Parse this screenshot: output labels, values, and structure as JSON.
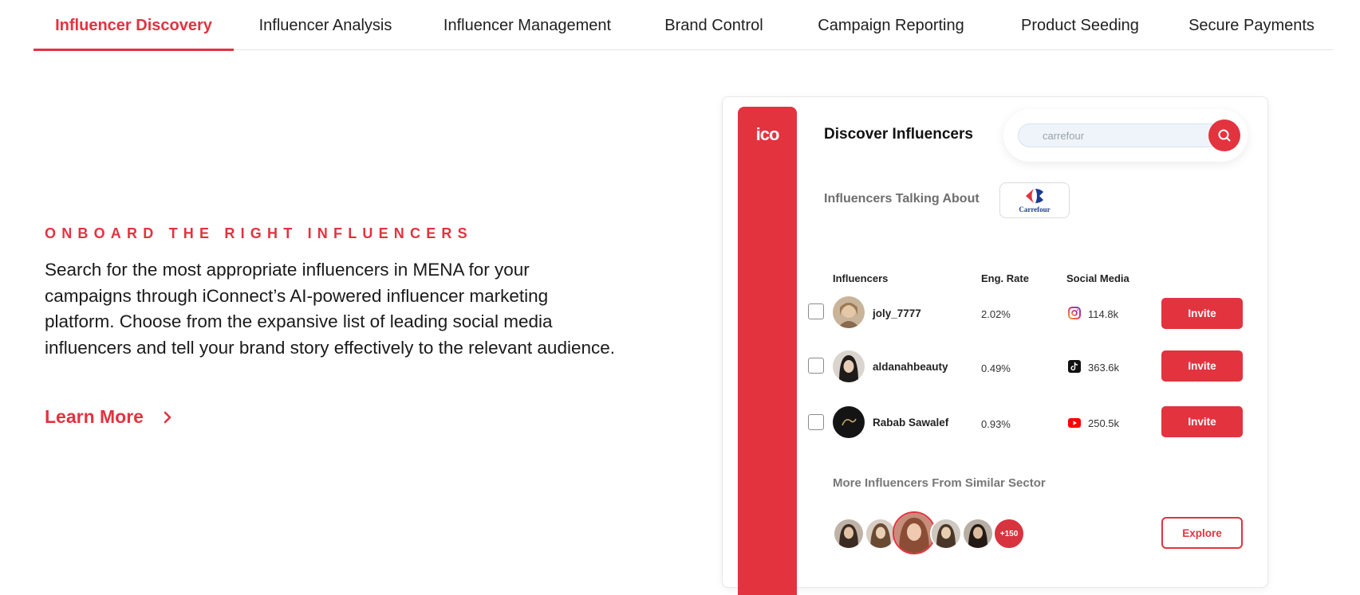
{
  "tabs": [
    {
      "label": "Influencer Discovery",
      "active": true
    },
    {
      "label": "Influencer Analysis",
      "active": false
    },
    {
      "label": "Influencer Management",
      "active": false
    },
    {
      "label": "Brand Control",
      "active": false
    },
    {
      "label": "Campaign Reporting",
      "active": false
    },
    {
      "label": "Product Seeding",
      "active": false
    },
    {
      "label": "Secure Payments",
      "active": false
    }
  ],
  "section": {
    "eyebrow": "ONBOARD THE RIGHT INFLUENCERS",
    "description": "Search for the most appropriate influencers in MENA for your campaigns through iConnect’s AI-powered influencer marketing platform. Choose from the expansive list of leading social media influencers and tell your brand story effectively to the relevant audience.",
    "learn_more": "Learn More"
  },
  "mockup": {
    "logo": "ico",
    "title": "Discover Influencers",
    "search_placeholder": "carrefour",
    "talking_about": "Influencers Talking About",
    "brand_name": "Carrefour",
    "headers": {
      "influencers": "Influencers",
      "eng_rate": "Eng. Rate",
      "social_media": "Social Media"
    },
    "rows": [
      {
        "name": "joly_7777",
        "eng_rate": "2.02%",
        "platform_icon": "instagram-icon",
        "followers": "114.8k",
        "action": "Invite"
      },
      {
        "name": "aldanahbeauty",
        "eng_rate": "0.49%",
        "platform_icon": "tiktok-icon",
        "followers": "363.6k",
        "action": "Invite"
      },
      {
        "name": "Rabab Sawalef",
        "eng_rate": "0.93%",
        "platform_icon": "youtube-icon",
        "followers": "250.5k",
        "action": "Invite"
      }
    ],
    "more_title": "More Influencers From Similar Sector",
    "more_count": "+150",
    "explore": "Explore"
  },
  "colors": {
    "accent": "#e2333f",
    "brand_blue": "#1b3c8e",
    "search_bg": "#eef4fa"
  }
}
